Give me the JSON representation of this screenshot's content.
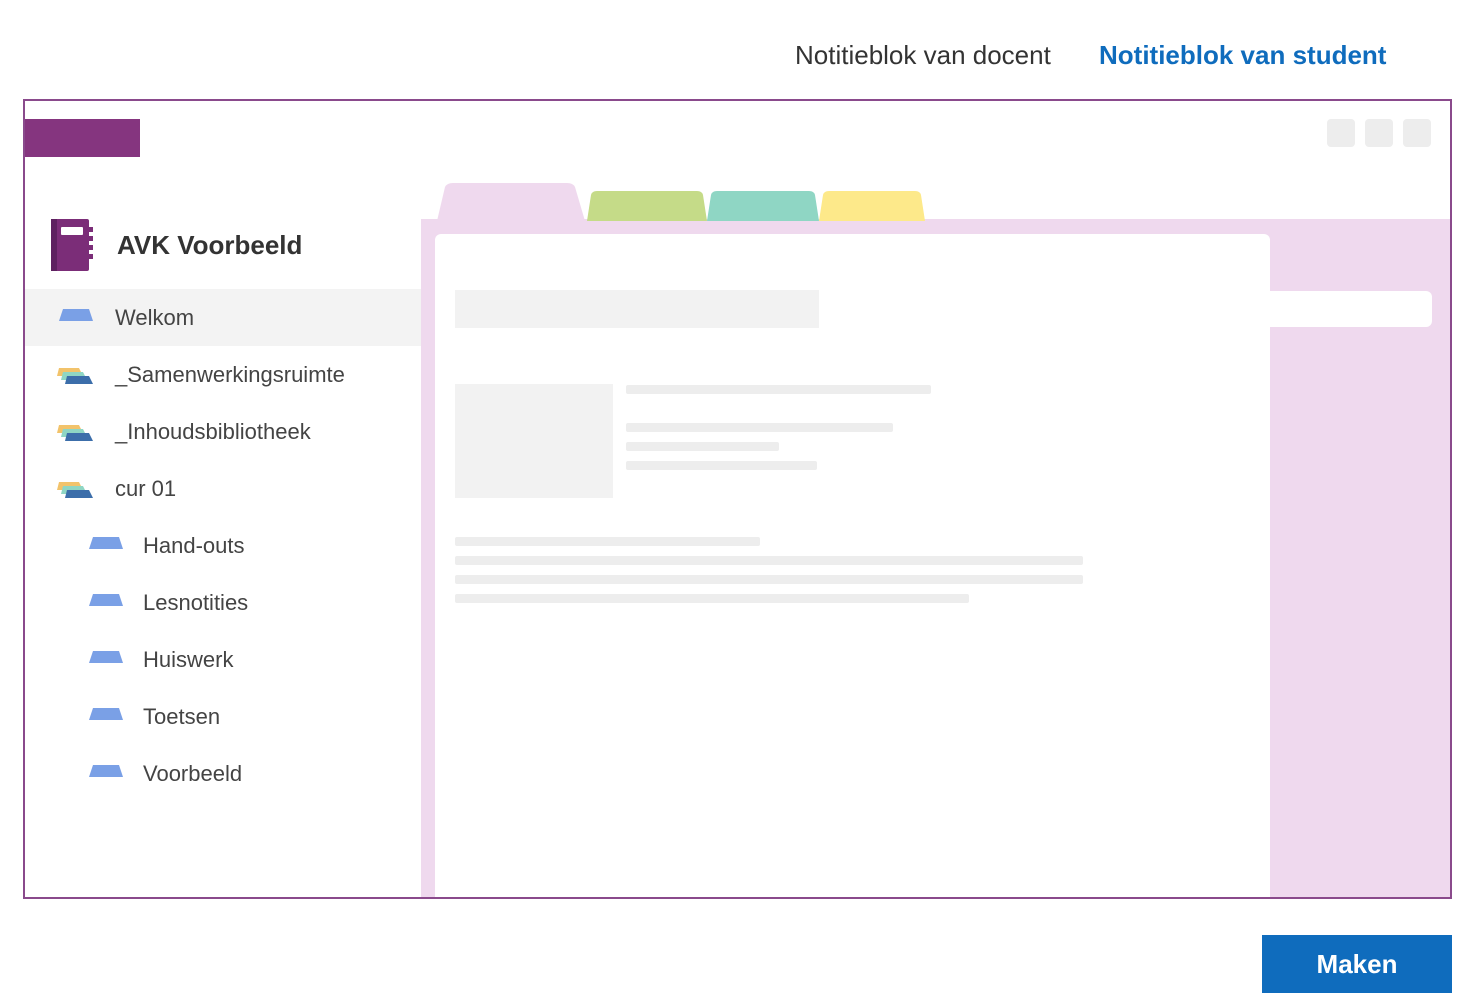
{
  "header": {
    "tabs": [
      {
        "label": "Notitieblok van docent",
        "active": false
      },
      {
        "label": "Notitieblok van student",
        "active": true
      }
    ]
  },
  "notebook": {
    "title": "AVK Voorbeeld",
    "icon": "notebook-icon",
    "sections": [
      {
        "label": "Welkom",
        "icon": "section-icon",
        "selected": true
      },
      {
        "label": "_Samenwerkingsruimte",
        "icon": "section-group-icon"
      },
      {
        "label": "_Inhoudsbibliotheek",
        "icon": "section-group-icon"
      },
      {
        "label": "cur 01",
        "icon": "section-group-icon"
      },
      {
        "label": "Hand-outs",
        "icon": "section-icon",
        "indent": 1
      },
      {
        "label": "Lesnotities",
        "icon": "section-icon",
        "indent": 1
      },
      {
        "label": "Huiswerk",
        "icon": "section-icon",
        "indent": 1
      },
      {
        "label": "Toetsen",
        "icon": "section-icon",
        "indent": 1
      },
      {
        "label": "Voorbeeld",
        "icon": "section-icon",
        "indent": 1
      }
    ]
  },
  "footer": {
    "create_label": "Maken"
  },
  "colors": {
    "accent_blue": "#0f6cbd",
    "brand_purple": "#85357f",
    "page_pink": "#efd9ee",
    "tab_green": "#c5db88",
    "tab_teal": "#8fd6c4",
    "tab_yellow": "#fde98a"
  }
}
